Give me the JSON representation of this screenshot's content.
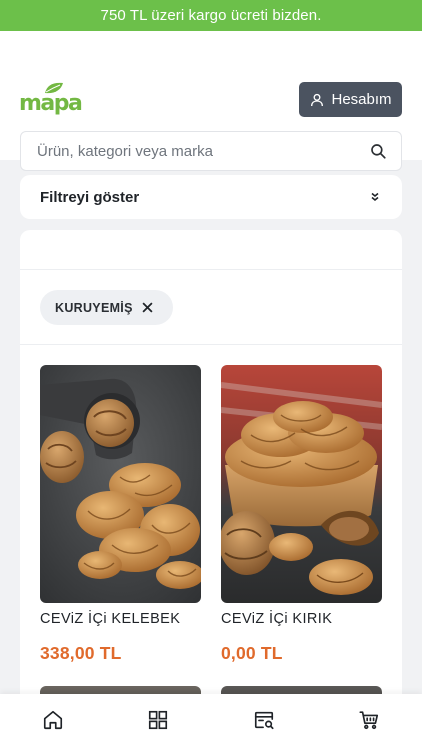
{
  "promo": {
    "text": "750 TL üzeri kargo ücreti bizden."
  },
  "header": {
    "logo_text": "mapa",
    "account_label": "Hesabım"
  },
  "search": {
    "placeholder": "Ürün, kategori veya marka"
  },
  "filter": {
    "label": "Filtreyi göster"
  },
  "active_filters": [
    {
      "label": "KURUYEMİŞ"
    }
  ],
  "products": [
    {
      "name": "CEViZ İÇi KELEBEK",
      "price": "338,00 TL",
      "image": "walnut-kernels-photo"
    },
    {
      "name": "CEViZ İÇi KIRIK",
      "price": "0,00 TL",
      "image": "walnut-bowl-photo"
    }
  ],
  "colors": {
    "promo": "#6cc04a",
    "brand": "#73b843",
    "price": "#e06a2c",
    "account_button": "#4b5360"
  },
  "bottom_nav": [
    {
      "icon": "home-icon"
    },
    {
      "icon": "categories-icon"
    },
    {
      "icon": "order-search-icon"
    },
    {
      "icon": "cart-icon"
    }
  ]
}
